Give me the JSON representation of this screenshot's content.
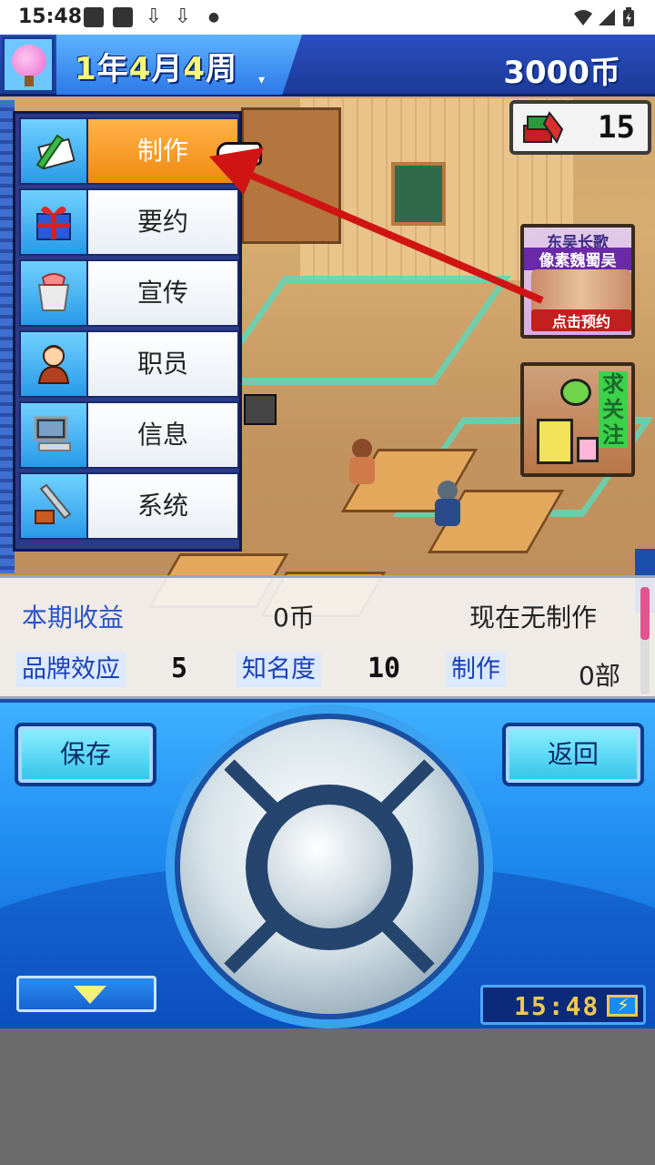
{
  "status_bar": {
    "time": "15:48",
    "icons": [
      "square-icon",
      "square-icon",
      "download-icon",
      "download-icon",
      "dot-icon",
      "wifi-icon",
      "signal-icon",
      "battery-icon"
    ]
  },
  "header": {
    "year": "1",
    "year_unit": "年",
    "month": "4",
    "month_unit": "月",
    "week": "4",
    "week_unit": "周",
    "money": "3000币",
    "avatar_icon": "cherry-tree-icon"
  },
  "fans": {
    "icon": "books-pen-icon",
    "value": "15"
  },
  "promos": {
    "card1": {
      "line1": "东吴长歌",
      "line2": "像素魏蜀吴",
      "cta": "点击预约"
    },
    "card2": {
      "vertical_text": [
        "求",
        "关",
        "注"
      ]
    }
  },
  "menu": {
    "items": [
      {
        "label": "制作",
        "icon": "pencil-paper-icon",
        "active": true
      },
      {
        "label": "要约",
        "icon": "gift-icon",
        "active": false
      },
      {
        "label": "宣传",
        "icon": "paper-basket-icon",
        "active": false
      },
      {
        "label": "职员",
        "icon": "staff-person-icon",
        "active": false
      },
      {
        "label": "信息",
        "icon": "computer-icon",
        "active": false
      },
      {
        "label": "系统",
        "icon": "wrench-toolbox-icon",
        "active": false
      }
    ]
  },
  "info_panel": {
    "income_label": "本期收益",
    "income_value": "0币",
    "production_status": "现在无制作",
    "brand_label": "品牌效应",
    "brand_value": "5",
    "fame_label": "知名度",
    "fame_value": "10",
    "production_label": "制作",
    "production_count": "0部"
  },
  "controller": {
    "save_label": "保存",
    "back_label": "返回",
    "clock": "15:48"
  },
  "colors": {
    "menu_active": "#f08a10",
    "accent_blue": "#2a56c8",
    "arrow_red": "#d01414"
  }
}
